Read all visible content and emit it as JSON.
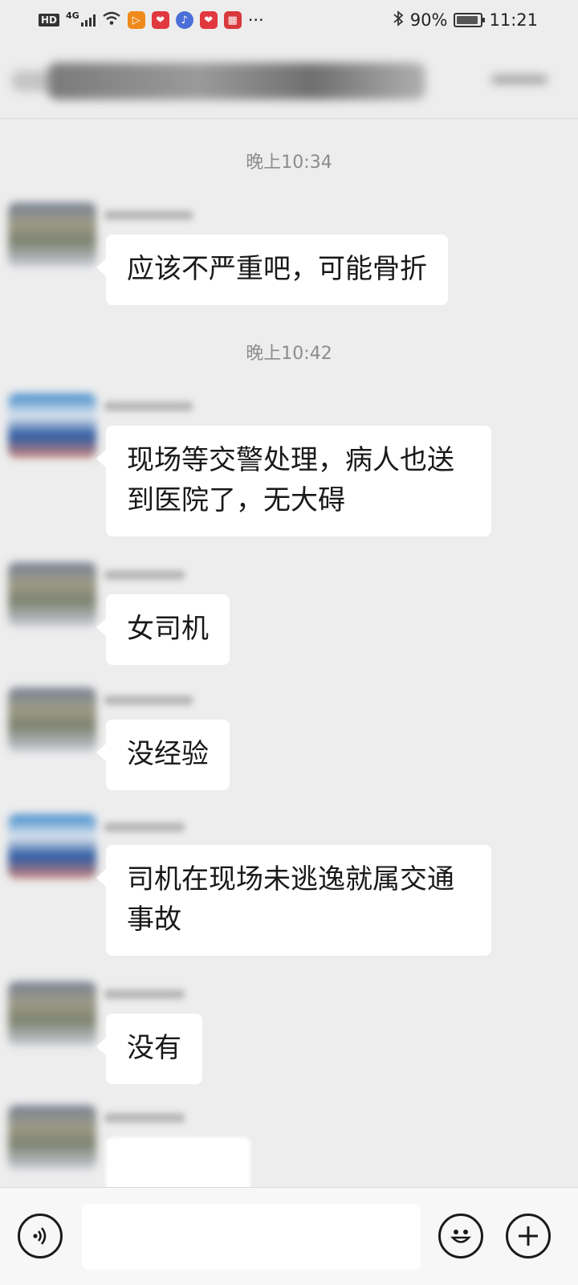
{
  "status_bar": {
    "network": "4G",
    "hd": "HD",
    "more": "···",
    "battery": "90%",
    "battery_level": 0.9,
    "time": "11:21",
    "icons": [
      "wifi-icon",
      "video-app-icon",
      "heart-app-icon",
      "music-app-icon",
      "heart-app-icon",
      "calendar-app-icon",
      "bluetooth-icon"
    ]
  },
  "messages": [
    {
      "type": "timestamp",
      "text": "晚上10:34"
    },
    {
      "type": "message",
      "avatar": "gray",
      "text": "应该不严重吧，可能骨折"
    },
    {
      "type": "timestamp",
      "text": "晚上10:42"
    },
    {
      "type": "message",
      "avatar": "blue",
      "text": "现场等交警处理，病人也送到医院了，无大碍"
    },
    {
      "type": "message",
      "avatar": "gray",
      "text": "女司机"
    },
    {
      "type": "message",
      "avatar": "gray",
      "text": "没经验"
    },
    {
      "type": "message",
      "avatar": "blue",
      "text": "司机在现场未逃逸就属交通事故"
    },
    {
      "type": "message",
      "avatar": "gray",
      "text": "没有"
    }
  ],
  "input_bar": {
    "icons": [
      "voice-icon",
      "emoji-icon",
      "plus-icon"
    ]
  },
  "colors": {
    "background": "#ededed",
    "bubble": "#ffffff",
    "timestamp_text": "#8c8c8c"
  }
}
